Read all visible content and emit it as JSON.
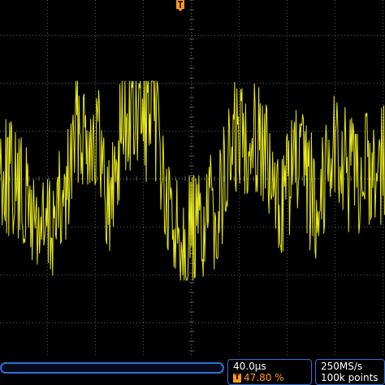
{
  "colors": {
    "background": "#000000",
    "trace": "#e6e619",
    "grid": "#5a5a5a",
    "trigger": "#ff9a1a",
    "frame": "#2f6fd6"
  },
  "trace": {
    "channel_color": "#e6e619",
    "description_icon": "waveform"
  },
  "trigger_marker": {
    "icon": "trigger-position-icon",
    "glyph": "T"
  },
  "timebase": {
    "scale": "40.0µs",
    "trigger_icon": "trigger-icon",
    "trigger_glyph": "T",
    "trigger_position": "47.80 %"
  },
  "acquisition": {
    "sample_rate": "250MS/s",
    "record_length": "100k points"
  }
}
